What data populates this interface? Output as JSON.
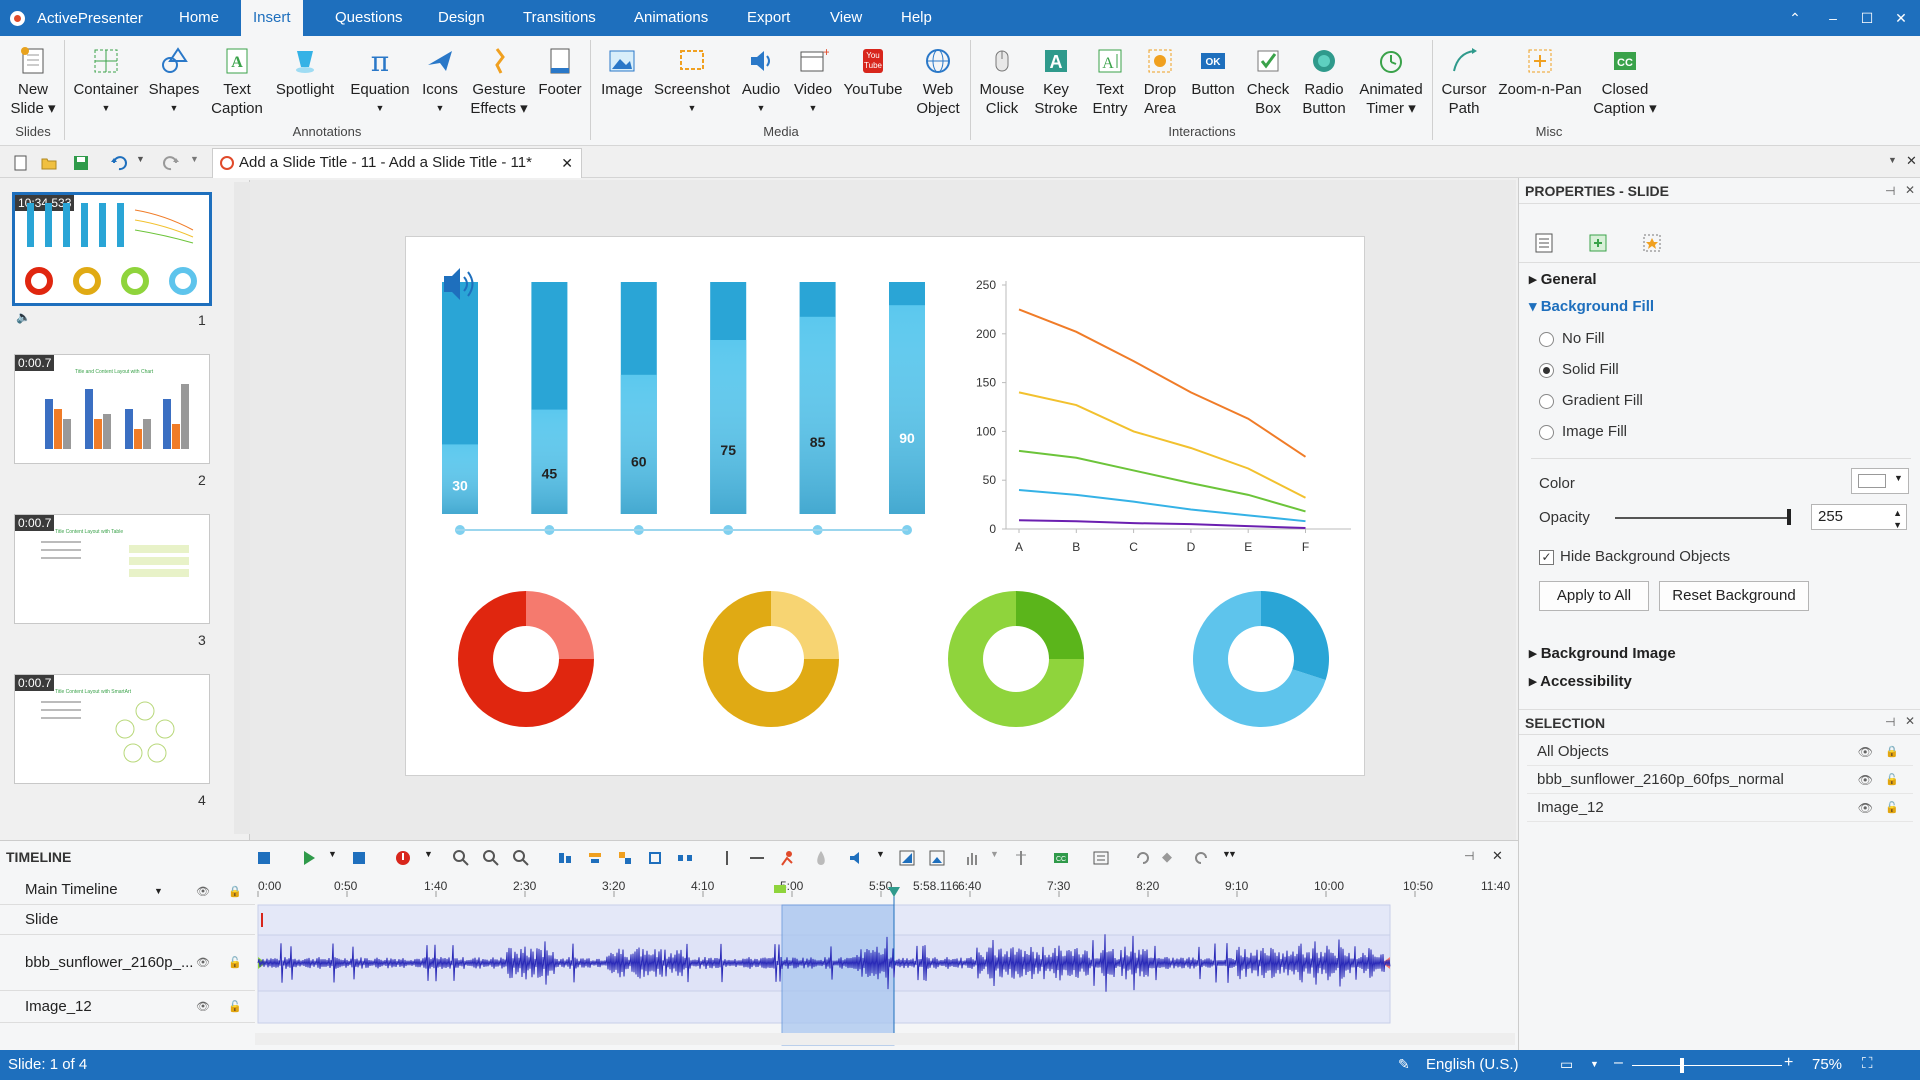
{
  "app": {
    "name": "ActivePresenter"
  },
  "menu": [
    {
      "label": "Home"
    },
    {
      "label": "Insert"
    },
    {
      "label": "Questions"
    },
    {
      "label": "Design"
    },
    {
      "label": "Transitions"
    },
    {
      "label": "Animations"
    },
    {
      "label": "Export"
    },
    {
      "label": "View"
    },
    {
      "label": "Help"
    }
  ],
  "ribbon": {
    "new_slide": "New\nSlide ▾",
    "groups": {
      "slides": "Slides",
      "annotations": "Annotations",
      "media": "Media",
      "interactions": "Interactions",
      "misc": "Misc"
    },
    "annotations": [
      "Container",
      "Shapes",
      "Text\nCaption",
      "Spotlight",
      "Equation",
      "Icons",
      "Gesture\nEffects ▾",
      "Footer"
    ],
    "media": [
      "Image",
      "Screenshot",
      "Audio",
      "Video",
      "YouTube",
      "Web\nObject"
    ],
    "interactions": [
      "Mouse\nClick",
      "Key\nStroke",
      "Text\nEntry",
      "Drop\nArea",
      "Button",
      "Check\nBox",
      "Radio\nButton",
      "Animated\nTimer ▾"
    ],
    "misc": [
      "Cursor\nPath",
      "Zoom-n-Pan",
      "Closed\nCaption ▾"
    ]
  },
  "doc_tab": {
    "title": "Add a Slide Title - 11 - Add a Slide Title - 11*"
  },
  "slides": [
    {
      "num": "1",
      "time": "10:34.533"
    },
    {
      "num": "2",
      "time": "0:00.7",
      "caption": "Title and Content Layout with Chart"
    },
    {
      "num": "3",
      "time": "0:00.7",
      "caption": "Title Content Layout with Table"
    },
    {
      "num": "4",
      "time": "0:00.7",
      "caption": "Title Content Layout with SmartArt"
    }
  ],
  "chart_data": [
    {
      "type": "bar",
      "categories": [
        "",
        "",
        "",
        "",
        "",
        ""
      ],
      "values": [
        30,
        45,
        60,
        75,
        85,
        90
      ],
      "labels": [
        "30",
        "45",
        "60",
        "75",
        "85",
        "90"
      ],
      "ylim": [
        0,
        100
      ],
      "colors": {
        "filled": "#5bc8ee",
        "remaining": "#2aa5d6"
      }
    },
    {
      "type": "line",
      "x": [
        "A",
        "B",
        "C",
        "D",
        "E",
        "F"
      ],
      "ylim": [
        0,
        250
      ],
      "yticks": [
        "0",
        "50",
        "100",
        "150",
        "200",
        "250"
      ],
      "series": [
        {
          "color": "#f07c28",
          "values": [
            225,
            202,
            172,
            140,
            113,
            74
          ]
        },
        {
          "color": "#f2c12e",
          "values": [
            140,
            127,
            100,
            83,
            62,
            32
          ]
        },
        {
          "color": "#6cc43a",
          "values": [
            80,
            73,
            60,
            47,
            35,
            18
          ]
        },
        {
          "color": "#35b2e6",
          "values": [
            40,
            35,
            28,
            20,
            14,
            8
          ]
        },
        {
          "color": "#6b1fb0",
          "values": [
            9,
            8,
            6,
            5,
            3,
            1
          ]
        }
      ]
    },
    {
      "type": "pie",
      "donuts": [
        {
          "color_main": "#e0260f",
          "color_part": "#f57a6e",
          "part": 0.25
        },
        {
          "color_main": "#e0aa14",
          "color_part": "#f7d472",
          "part": 0.25
        },
        {
          "color_main": "#8fd43c",
          "color_part": "#5bb51b",
          "part": 0.25
        },
        {
          "color_main": "#5ec4ec",
          "color_part": "#2aa5d6",
          "part": 0.3
        }
      ]
    }
  ],
  "props": {
    "title": "PROPERTIES - SLIDE",
    "general": "General",
    "bg_fill": "Background Fill",
    "fill_options": [
      "No Fill",
      "Solid Fill",
      "Gradient Fill",
      "Image Fill"
    ],
    "selected_fill": "Solid Fill",
    "color_label": "Color",
    "opacity_label": "Opacity",
    "opacity_value": "255",
    "hide_bg_label": "Hide Background Objects",
    "hide_bg_checked": true,
    "apply_all": "Apply to All",
    "reset_bg": "Reset Background",
    "bg_image": "Background Image",
    "accessibility": "Accessibility"
  },
  "selection": {
    "title": "SELECTION",
    "rows": [
      "All Objects",
      "bbb_sunflower_2160p_60fps_normal",
      "Image_12"
    ]
  },
  "timeline": {
    "title": "TIMELINE",
    "main": "Main Timeline",
    "rows": [
      "Slide",
      "bbb_sunflower_2160p_...",
      "Image_12"
    ],
    "ticks": [
      "0:00",
      "0:50",
      "1:40",
      "2:30",
      "3:20",
      "4:10",
      "5:00",
      "5:50",
      "5:58.116",
      "6:40",
      "7:30",
      "8:20",
      "9:10",
      "10:00",
      "10:50",
      "11:40"
    ]
  },
  "status": {
    "slide": "Slide: 1 of 4",
    "language": "English (U.S.)",
    "zoom": "75%"
  }
}
